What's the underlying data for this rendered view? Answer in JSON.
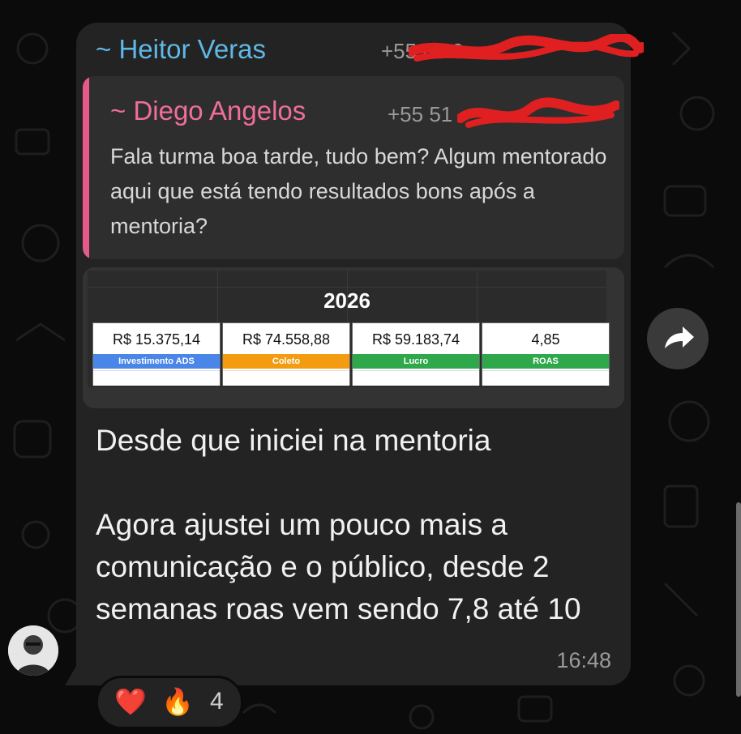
{
  "message": {
    "sender_name": "~ Heitor Veras",
    "sender_phone": "+55 85 9",
    "quoted": {
      "name": "~ Diego Angelos",
      "phone": "+55 51",
      "text": "Fala turma boa tarde, tudo bem? Algum mentorado aqui que está tendo resultados bons após a mentoria?"
    },
    "media": {
      "title": "2026",
      "cards": [
        {
          "value": "R$ 15.375,14",
          "label": "Investimento ADS",
          "color": "#4a86e8"
        },
        {
          "value": "R$ 74.558,88",
          "label": "Coleto",
          "color": "#f39c12"
        },
        {
          "value": "R$ 59.183,74",
          "label": "Lucro",
          "color": "#2ea84a"
        },
        {
          "value": "4,85",
          "label": "ROAS",
          "color": "#2ea84a"
        }
      ]
    },
    "text": "Desde que iniciei na mentoria\n\nAgora ajustei um pouco mais a comunicação e o público, desde 2 semanas roas vem sendo 7,8 até 10",
    "time": "16:48"
  },
  "reactions": {
    "emojis": [
      "❤️",
      "🔥"
    ],
    "count": "4"
  },
  "colors": {
    "sender_name": "#5fb8e6",
    "quoted_name": "#ef6e9b",
    "bubble": "#232323",
    "background": "#0b0b0b"
  },
  "icons": [
    "forward-icon",
    "avatar"
  ]
}
